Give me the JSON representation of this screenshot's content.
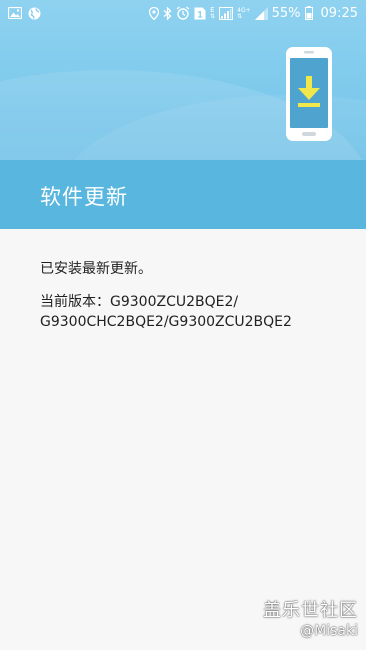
{
  "status_bar": {
    "left_icons": [
      "gallery-icon",
      "globe-icon"
    ],
    "right_icons": [
      "location-icon",
      "bluetooth-icon",
      "alarm-icon",
      "sim-1-icon",
      "e-data-icon",
      "signal-icon",
      "4g-plus-icon",
      "signal-icon"
    ],
    "network_e": "E",
    "network_4g": "4G+",
    "sim_number": "1",
    "battery_percent": "55%",
    "time": "09:25"
  },
  "header": {
    "title": "软件更新",
    "illustration": "phone-download-icon"
  },
  "content": {
    "status_message": "已安装最新更新。",
    "version_line_1": "当前版本：G9300ZCU2BQE2/",
    "version_line_2": "G9300CHC2BQE2/G9300ZCU2BQE2"
  },
  "watermark": {
    "title": "盖乐世社区",
    "user": "@Misaki"
  },
  "colors": {
    "banner": "#8fd2f0",
    "title_bar": "#59b6de",
    "background": "#f7f7f7",
    "accent_yellow": "#f0e84a"
  }
}
